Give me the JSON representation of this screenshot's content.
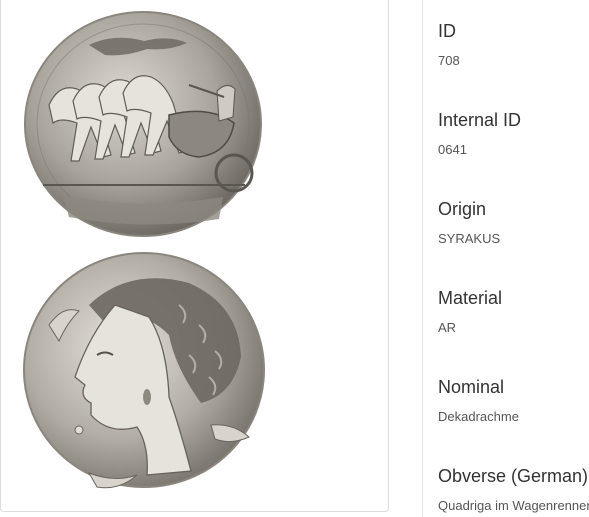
{
  "coin": {
    "reverse_image": "coin-reverse-quadriga",
    "obverse_image": "coin-obverse-head"
  },
  "fields": [
    {
      "label": "ID",
      "value": "708"
    },
    {
      "label": "Internal ID",
      "value": "0641"
    },
    {
      "label": "Origin",
      "value": "SYRAKUS"
    },
    {
      "label": "Material",
      "value": "AR"
    },
    {
      "label": "Nominal",
      "value": "Dekadrachme"
    },
    {
      "label": "Obverse (German)",
      "value": "Quadriga im Wagenrennen"
    }
  ],
  "colors": {
    "coin_silver": "#a9a49b",
    "coin_shadow": "#5e5a54",
    "coin_highlight": "#e4e1da"
  }
}
